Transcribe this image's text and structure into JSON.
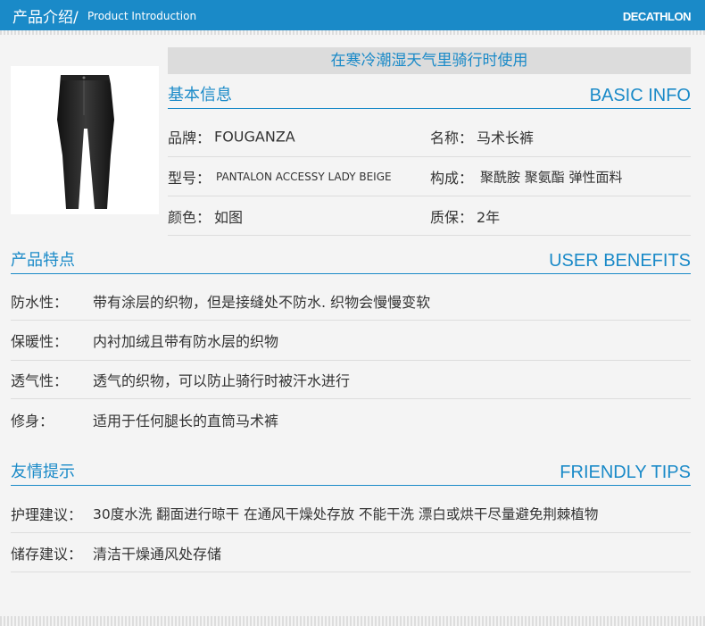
{
  "header": {
    "title_cn": "产品介绍/",
    "title_en": "Product Introduction",
    "brand": "DECATHLON",
    "bg_color": "#1a8ac8"
  },
  "banner": "在寒冷潮湿天气里骑行时使用",
  "basic_info": {
    "title_cn": "基本信息",
    "title_en": "BASIC INFO",
    "brand_label": "品牌：",
    "brand_value": "FOUGANZA",
    "name_label": "名称：",
    "name_value": "马术长裤",
    "model_label": "型号：",
    "model_value": "PANTALON ACCESSY LADY BEIGE",
    "composition_label": "构成：",
    "composition_value": "聚酰胺 聚氨酯 弹性面料",
    "color_label": "颜色：",
    "color_value": "如图",
    "warranty_label": "质保：",
    "warranty_value": "2年"
  },
  "benefits": {
    "title_cn": "产品特点",
    "title_en": "USER BENEFITS",
    "items": [
      {
        "label": "防水性：",
        "value": "带有涂层的织物，但是接缝处不防水. 织物会慢慢变软"
      },
      {
        "label": "保暖性：",
        "value": "内衬加绒且带有防水层的织物"
      },
      {
        "label": "透气性：",
        "value": "透气的织物，可以防止骑行时被汗水进行"
      },
      {
        "label": "修身：",
        "value": "适用于任何腿长的直筒马术裤"
      }
    ]
  },
  "tips": {
    "title_cn": "友情提示",
    "title_en": "FRIENDLY TIPS",
    "items": [
      {
        "label": "护理建议：",
        "value": "30度水洗 翻面进行晾干 在通风干燥处存放 不能干洗 漂白或烘干尽量避免荆棘植物"
      },
      {
        "label": "储存建议：",
        "value": "清洁干燥通风处存储"
      }
    ]
  },
  "accent_color": "#1a8ac8"
}
